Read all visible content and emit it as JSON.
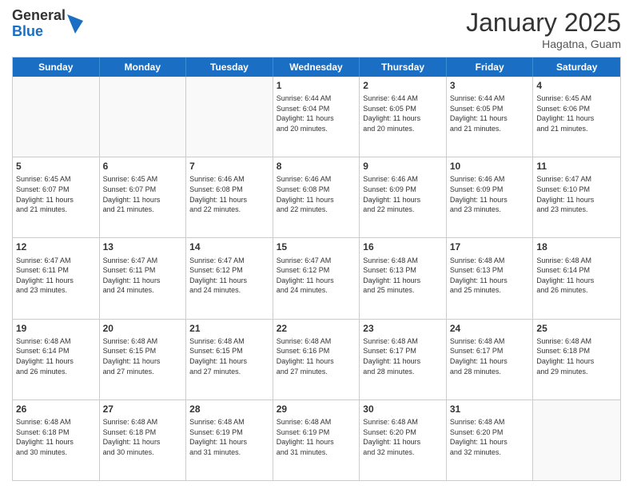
{
  "header": {
    "logo_general": "General",
    "logo_blue": "Blue",
    "month_title": "January 2025",
    "subtitle": "Hagatna, Guam"
  },
  "weekdays": [
    "Sunday",
    "Monday",
    "Tuesday",
    "Wednesday",
    "Thursday",
    "Friday",
    "Saturday"
  ],
  "rows": [
    [
      {
        "day": "",
        "lines": []
      },
      {
        "day": "",
        "lines": []
      },
      {
        "day": "",
        "lines": []
      },
      {
        "day": "1",
        "lines": [
          "Sunrise: 6:44 AM",
          "Sunset: 6:04 PM",
          "Daylight: 11 hours",
          "and 20 minutes."
        ]
      },
      {
        "day": "2",
        "lines": [
          "Sunrise: 6:44 AM",
          "Sunset: 6:05 PM",
          "Daylight: 11 hours",
          "and 20 minutes."
        ]
      },
      {
        "day": "3",
        "lines": [
          "Sunrise: 6:44 AM",
          "Sunset: 6:05 PM",
          "Daylight: 11 hours",
          "and 21 minutes."
        ]
      },
      {
        "day": "4",
        "lines": [
          "Sunrise: 6:45 AM",
          "Sunset: 6:06 PM",
          "Daylight: 11 hours",
          "and 21 minutes."
        ]
      }
    ],
    [
      {
        "day": "5",
        "lines": [
          "Sunrise: 6:45 AM",
          "Sunset: 6:07 PM",
          "Daylight: 11 hours",
          "and 21 minutes."
        ]
      },
      {
        "day": "6",
        "lines": [
          "Sunrise: 6:45 AM",
          "Sunset: 6:07 PM",
          "Daylight: 11 hours",
          "and 21 minutes."
        ]
      },
      {
        "day": "7",
        "lines": [
          "Sunrise: 6:46 AM",
          "Sunset: 6:08 PM",
          "Daylight: 11 hours",
          "and 22 minutes."
        ]
      },
      {
        "day": "8",
        "lines": [
          "Sunrise: 6:46 AM",
          "Sunset: 6:08 PM",
          "Daylight: 11 hours",
          "and 22 minutes."
        ]
      },
      {
        "day": "9",
        "lines": [
          "Sunrise: 6:46 AM",
          "Sunset: 6:09 PM",
          "Daylight: 11 hours",
          "and 22 minutes."
        ]
      },
      {
        "day": "10",
        "lines": [
          "Sunrise: 6:46 AM",
          "Sunset: 6:09 PM",
          "Daylight: 11 hours",
          "and 23 minutes."
        ]
      },
      {
        "day": "11",
        "lines": [
          "Sunrise: 6:47 AM",
          "Sunset: 6:10 PM",
          "Daylight: 11 hours",
          "and 23 minutes."
        ]
      }
    ],
    [
      {
        "day": "12",
        "lines": [
          "Sunrise: 6:47 AM",
          "Sunset: 6:11 PM",
          "Daylight: 11 hours",
          "and 23 minutes."
        ]
      },
      {
        "day": "13",
        "lines": [
          "Sunrise: 6:47 AM",
          "Sunset: 6:11 PM",
          "Daylight: 11 hours",
          "and 24 minutes."
        ]
      },
      {
        "day": "14",
        "lines": [
          "Sunrise: 6:47 AM",
          "Sunset: 6:12 PM",
          "Daylight: 11 hours",
          "and 24 minutes."
        ]
      },
      {
        "day": "15",
        "lines": [
          "Sunrise: 6:47 AM",
          "Sunset: 6:12 PM",
          "Daylight: 11 hours",
          "and 24 minutes."
        ]
      },
      {
        "day": "16",
        "lines": [
          "Sunrise: 6:48 AM",
          "Sunset: 6:13 PM",
          "Daylight: 11 hours",
          "and 25 minutes."
        ]
      },
      {
        "day": "17",
        "lines": [
          "Sunrise: 6:48 AM",
          "Sunset: 6:13 PM",
          "Daylight: 11 hours",
          "and 25 minutes."
        ]
      },
      {
        "day": "18",
        "lines": [
          "Sunrise: 6:48 AM",
          "Sunset: 6:14 PM",
          "Daylight: 11 hours",
          "and 26 minutes."
        ]
      }
    ],
    [
      {
        "day": "19",
        "lines": [
          "Sunrise: 6:48 AM",
          "Sunset: 6:14 PM",
          "Daylight: 11 hours",
          "and 26 minutes."
        ]
      },
      {
        "day": "20",
        "lines": [
          "Sunrise: 6:48 AM",
          "Sunset: 6:15 PM",
          "Daylight: 11 hours",
          "and 27 minutes."
        ]
      },
      {
        "day": "21",
        "lines": [
          "Sunrise: 6:48 AM",
          "Sunset: 6:15 PM",
          "Daylight: 11 hours",
          "and 27 minutes."
        ]
      },
      {
        "day": "22",
        "lines": [
          "Sunrise: 6:48 AM",
          "Sunset: 6:16 PM",
          "Daylight: 11 hours",
          "and 27 minutes."
        ]
      },
      {
        "day": "23",
        "lines": [
          "Sunrise: 6:48 AM",
          "Sunset: 6:17 PM",
          "Daylight: 11 hours",
          "and 28 minutes."
        ]
      },
      {
        "day": "24",
        "lines": [
          "Sunrise: 6:48 AM",
          "Sunset: 6:17 PM",
          "Daylight: 11 hours",
          "and 28 minutes."
        ]
      },
      {
        "day": "25",
        "lines": [
          "Sunrise: 6:48 AM",
          "Sunset: 6:18 PM",
          "Daylight: 11 hours",
          "and 29 minutes."
        ]
      }
    ],
    [
      {
        "day": "26",
        "lines": [
          "Sunrise: 6:48 AM",
          "Sunset: 6:18 PM",
          "Daylight: 11 hours",
          "and 30 minutes."
        ]
      },
      {
        "day": "27",
        "lines": [
          "Sunrise: 6:48 AM",
          "Sunset: 6:18 PM",
          "Daylight: 11 hours",
          "and 30 minutes."
        ]
      },
      {
        "day": "28",
        "lines": [
          "Sunrise: 6:48 AM",
          "Sunset: 6:19 PM",
          "Daylight: 11 hours",
          "and 31 minutes."
        ]
      },
      {
        "day": "29",
        "lines": [
          "Sunrise: 6:48 AM",
          "Sunset: 6:19 PM",
          "Daylight: 11 hours",
          "and 31 minutes."
        ]
      },
      {
        "day": "30",
        "lines": [
          "Sunrise: 6:48 AM",
          "Sunset: 6:20 PM",
          "Daylight: 11 hours",
          "and 32 minutes."
        ]
      },
      {
        "day": "31",
        "lines": [
          "Sunrise: 6:48 AM",
          "Sunset: 6:20 PM",
          "Daylight: 11 hours",
          "and 32 minutes."
        ]
      },
      {
        "day": "",
        "lines": []
      }
    ]
  ]
}
